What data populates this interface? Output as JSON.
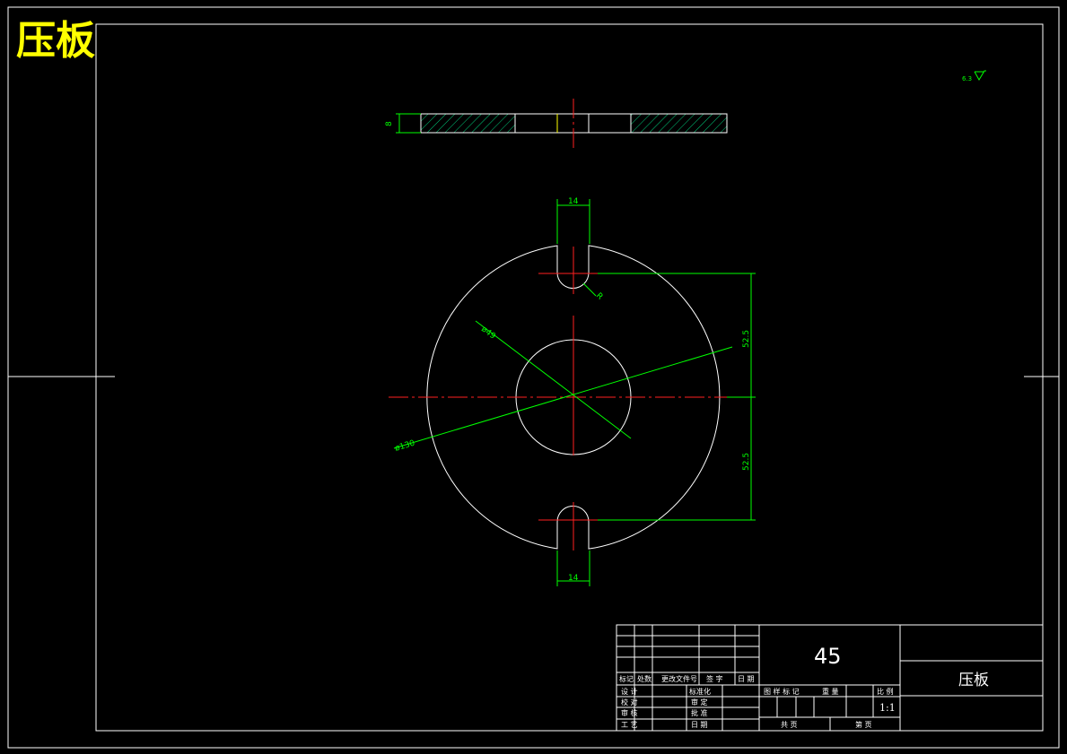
{
  "drawing": {
    "title": "压板",
    "roughness": "6.3"
  },
  "dimensions": {
    "thickness": "8",
    "slot_width_top": "14",
    "slot_width_bottom": "14",
    "slot_radius": "R",
    "inner_diameter": "ø49",
    "outer_diameter": "ø130",
    "half_spacing_upper": "52.5",
    "half_spacing_lower": "52.5"
  },
  "title_block": {
    "material": "45",
    "part_name": "压板",
    "scale": "1:1",
    "revision_headers": [
      "标记",
      "处数",
      "更改文件号",
      "签 字",
      "日 期"
    ],
    "rows_left": [
      "设 计",
      "校 对",
      "审 核",
      "工 艺"
    ],
    "rows_mid": [
      "标准化",
      "审 定",
      "批 准",
      "日 期"
    ],
    "stage_headers": [
      "图 样 标 记",
      "重 量",
      "比 例"
    ],
    "sheet_total": "共 页",
    "sheet_no": "第 页"
  },
  "colors": {
    "background": "#000000",
    "outline": "#ffffff",
    "dimension": "#00ff00",
    "centerline": "#ff2020",
    "title_text": "#ffff00"
  }
}
